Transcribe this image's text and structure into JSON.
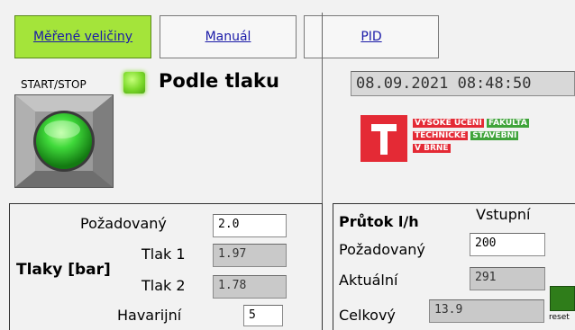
{
  "tabs": [
    "Měřené veličiny",
    "Manuál",
    "PID"
  ],
  "start_stop_label": "START/STOP",
  "mode_label": "Podle tlaku",
  "datetime": "08.09.2021 08:48:50",
  "logo": {
    "line1a": "VYSOKÉ UČENÍ",
    "line1b": "FAKULTA",
    "line2a": "TECHNICKÉ",
    "line2b": "STAVEBNÍ",
    "line3": "V BRNĚ",
    "colors": {
      "red": "#e42a35",
      "green": "#3fa33a"
    }
  },
  "pressure": {
    "title": "Tlaky [bar]",
    "required_label": "Požadovaný",
    "required_value": "2.0",
    "p1_label": "Tlak 1",
    "p1_value": "1.97",
    "p2_label": "Tlak 2",
    "p2_value": "1.78",
    "emergency_label": "Havarijní",
    "emergency_value": "5"
  },
  "flow": {
    "title": "Průtok l/h",
    "column_label": "Vstupní",
    "required_label": "Požadovaný",
    "required_value": "200",
    "actual_label": "Aktuální",
    "actual_value": "291",
    "total_label": "Celkový",
    "total_value": "13.9",
    "reset_label": "reset"
  }
}
